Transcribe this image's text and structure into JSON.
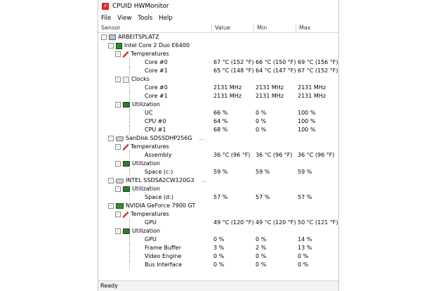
{
  "window": {
    "title": "CPUID HWMonitor"
  },
  "menu": [
    "File",
    "View",
    "Tools",
    "Help"
  ],
  "columns": {
    "sensor": "Sensor",
    "value": "Value",
    "min": "Min",
    "max": "Max"
  },
  "rows": [
    {
      "level": 0,
      "icon": "computer-icon",
      "label": "ARBEITSPLATZ",
      "exp": "-"
    },
    {
      "level": 1,
      "icon": "cpu-icon",
      "label": "Intel Core 2 Duo E6400",
      "exp": "-"
    },
    {
      "level": 2,
      "icon": "thermometer-icon",
      "label": "Temperatures",
      "exp": "-"
    },
    {
      "level": 3,
      "label": "Core #0",
      "value": "67 °C  (152 °F)",
      "min": "66 °C  (150 °F)",
      "max": "69 °C  (156 °F)"
    },
    {
      "level": 3,
      "label": "Core #1",
      "value": "65 °C  (148 °F)",
      "min": "64 °C  (147 °F)",
      "max": "67 °C  (152 °F)"
    },
    {
      "level": 2,
      "icon": "clock-icon",
      "label": "Clocks",
      "exp": "-"
    },
    {
      "level": 3,
      "label": "Core #0",
      "value": "2131 MHz",
      "min": "2131 MHz",
      "max": "2131 MHz"
    },
    {
      "level": 3,
      "label": "Core #1",
      "value": "2131 MHz",
      "min": "2131 MHz",
      "max": "2131 MHz"
    },
    {
      "level": 2,
      "icon": "utilization-icon",
      "label": "Utilization",
      "exp": "-"
    },
    {
      "level": 3,
      "label": "UC",
      "value": "66 %",
      "min": "0 %",
      "max": "100 %"
    },
    {
      "level": 3,
      "label": "CPU #0",
      "value": "64 %",
      "min": "0 %",
      "max": "100 %"
    },
    {
      "level": 3,
      "label": "CPU #1",
      "value": "68 %",
      "min": "0 %",
      "max": "100 %"
    },
    {
      "level": 1,
      "icon": "disk-icon",
      "label": "SanDisk SDSSDHP256G",
      "exp": "-",
      "extra": "..."
    },
    {
      "level": 2,
      "icon": "thermometer-icon",
      "label": "Temperatures",
      "exp": "-"
    },
    {
      "level": 3,
      "label": "Assembly",
      "value": "36 °C  (96 °F)",
      "min": "36 °C  (96 °F)",
      "max": "36 °C  (96 °F)"
    },
    {
      "level": 2,
      "icon": "utilization-icon",
      "label": "Utilization",
      "exp": "-"
    },
    {
      "level": 3,
      "label": "Space (c:)",
      "value": "59 %",
      "min": "59 %",
      "max": "59 %"
    },
    {
      "level": 1,
      "icon": "disk-icon",
      "label": "INTEL SSDSA2CW120G3",
      "exp": "-",
      "extra": "..."
    },
    {
      "level": 2,
      "icon": "utilization-icon",
      "label": "Utilization",
      "exp": "-"
    },
    {
      "level": 3,
      "label": "Space (d:)",
      "value": "57 %",
      "min": "57 %",
      "max": "57 %"
    },
    {
      "level": 1,
      "icon": "gpu-icon",
      "label": "NVIDIA GeForce 7900 GT",
      "exp": "-"
    },
    {
      "level": 2,
      "icon": "thermometer-icon",
      "label": "Temperatures",
      "exp": "-"
    },
    {
      "level": 3,
      "label": "GPU",
      "value": "49 °C  (120 °F)",
      "min": "49 °C  (120 °F)",
      "max": "50 °C  (121 °F)"
    },
    {
      "level": 2,
      "icon": "utilization-icon",
      "label": "Utilization",
      "exp": "-"
    },
    {
      "level": 3,
      "label": "GPU",
      "value": "0 %",
      "min": "0 %",
      "max": "14 %"
    },
    {
      "level": 3,
      "label": "Frame Buffer",
      "value": "3 %",
      "min": "2 %",
      "max": "13 %"
    },
    {
      "level": 3,
      "label": "Video Engine",
      "value": "0 %",
      "min": "0 %",
      "max": "0 %"
    },
    {
      "level": 3,
      "label": "Bus Interface",
      "value": "0 %",
      "min": "0 %",
      "max": "0 %"
    }
  ],
  "status": "Ready"
}
